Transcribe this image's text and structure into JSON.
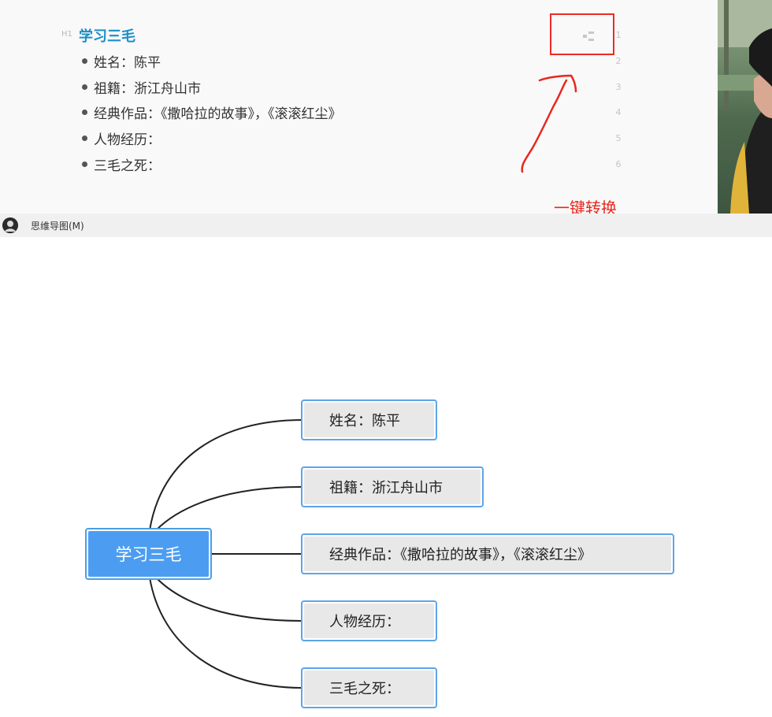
{
  "editor": {
    "heading_tag": "H1",
    "heading": "学习三毛",
    "bullets": [
      "姓名：陈平",
      "祖籍：浙江舟山市",
      "经典作品：《撒哈拉的故事》，《滚滚红尘》",
      "人物经历：",
      "三毛之死："
    ],
    "line_numbers": [
      "1",
      "2",
      "3",
      "4",
      "5",
      "6"
    ]
  },
  "annotation": {
    "label": "一键转换",
    "color": "#e8281f"
  },
  "statusbar": {
    "mode_label": "思维导图(M)"
  },
  "mindmap": {
    "root": "学习三毛",
    "children": [
      "姓名：陈平",
      "祖籍：浙江舟山市",
      "经典作品：《撒哈拉的故事》，《滚滚红尘》",
      "人物经历：",
      "三毛之死："
    ]
  },
  "colors": {
    "heading": "#1a8fc9",
    "root_fill": "#4c9df2",
    "node_border": "#5ea4e8",
    "node_fill": "#e8e8e8"
  }
}
